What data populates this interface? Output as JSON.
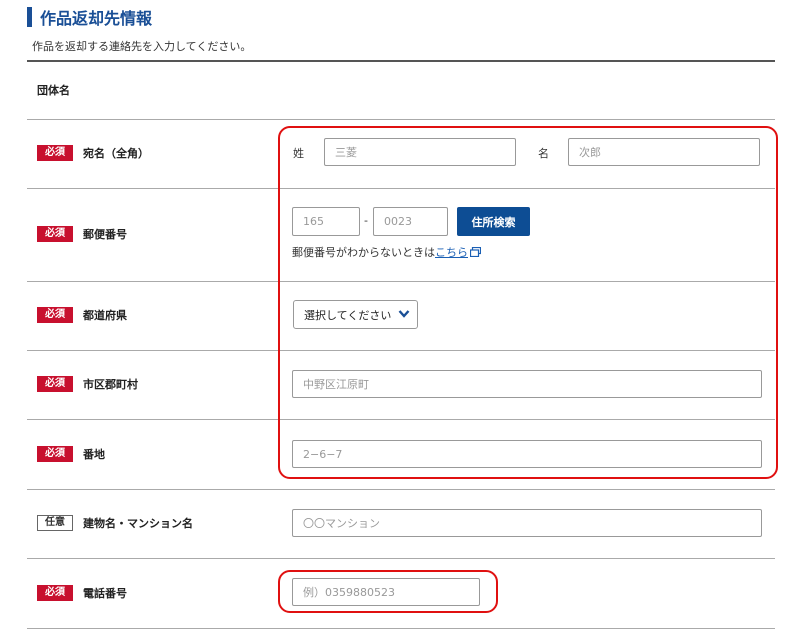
{
  "header": {
    "title": "作品返却先情報",
    "subtitle": "作品を返却する連絡先を入力してください。"
  },
  "rows": {
    "group": {
      "label": "団体名"
    },
    "name": {
      "badge": "必須",
      "label": "宛名（全角）",
      "last_label": "姓",
      "last_placeholder": "三菱",
      "first_label": "名",
      "first_placeholder": "次郎"
    },
    "postal": {
      "badge": "必須",
      "label": "郵便番号",
      "code1_placeholder": "165",
      "separator": "-",
      "code2_placeholder": "0023",
      "search_button": "住所検索",
      "help_text": "郵便番号がわからないときは",
      "help_link": "こちら"
    },
    "prefecture": {
      "badge": "必須",
      "label": "都道府県",
      "selected": "選択してください"
    },
    "city": {
      "badge": "必須",
      "label": "市区郡町村",
      "placeholder": "中野区江原町"
    },
    "street": {
      "badge": "必須",
      "label": "番地",
      "placeholder": "2−6−7"
    },
    "building": {
      "badge": "任意",
      "label": "建物名・マンション名",
      "placeholder": "〇〇マンション"
    },
    "phone": {
      "badge": "必須",
      "label": "電話番号",
      "placeholder": "例）0359880523"
    }
  },
  "colors": {
    "accent": "#1a4f96",
    "required": "#c8102e",
    "button": "#0d4d94",
    "highlight": "#e01010"
  }
}
